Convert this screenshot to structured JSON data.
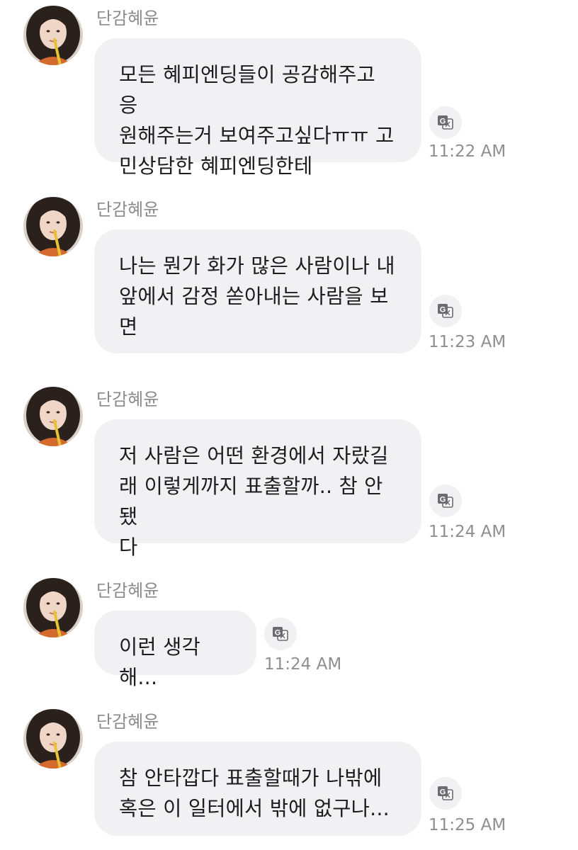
{
  "messages": [
    {
      "sender": "단감혜윤",
      "text": "모든 혜피엔딩들이 공감해주고 응\n원해주는거 보여주고싶다ㅠㅠ 고\n민상담한 혜피엔딩한테",
      "time": "11:22 AM"
    },
    {
      "sender": "단감혜윤",
      "text": "나는 뭔가 화가 많은 사람이나 내\n앞에서 감정 쏟아내는 사람을 보\n면",
      "time": "11:23 AM"
    },
    {
      "sender": "단감혜윤",
      "text": "저 사람은 어떤 환경에서 자랐길\n래 이렇게까지 표출할까.. 참 안됐\n다",
      "time": "11:24 AM"
    },
    {
      "sender": "단감혜윤",
      "text": "이런 생각해...",
      "time": "11:24 AM"
    },
    {
      "sender": "단감혜윤",
      "text": "참 안타깝다 표출할때가 나밖에\n혹은 이 일터에서 밖에 없구나...",
      "time": "11:25 AM"
    }
  ],
  "icons": {
    "translate": "translate-icon"
  },
  "colors": {
    "bubble": "#f1f1f4",
    "sender": "#8a8a8e",
    "time": "#8f8f93",
    "text": "#1d1d1f"
  }
}
